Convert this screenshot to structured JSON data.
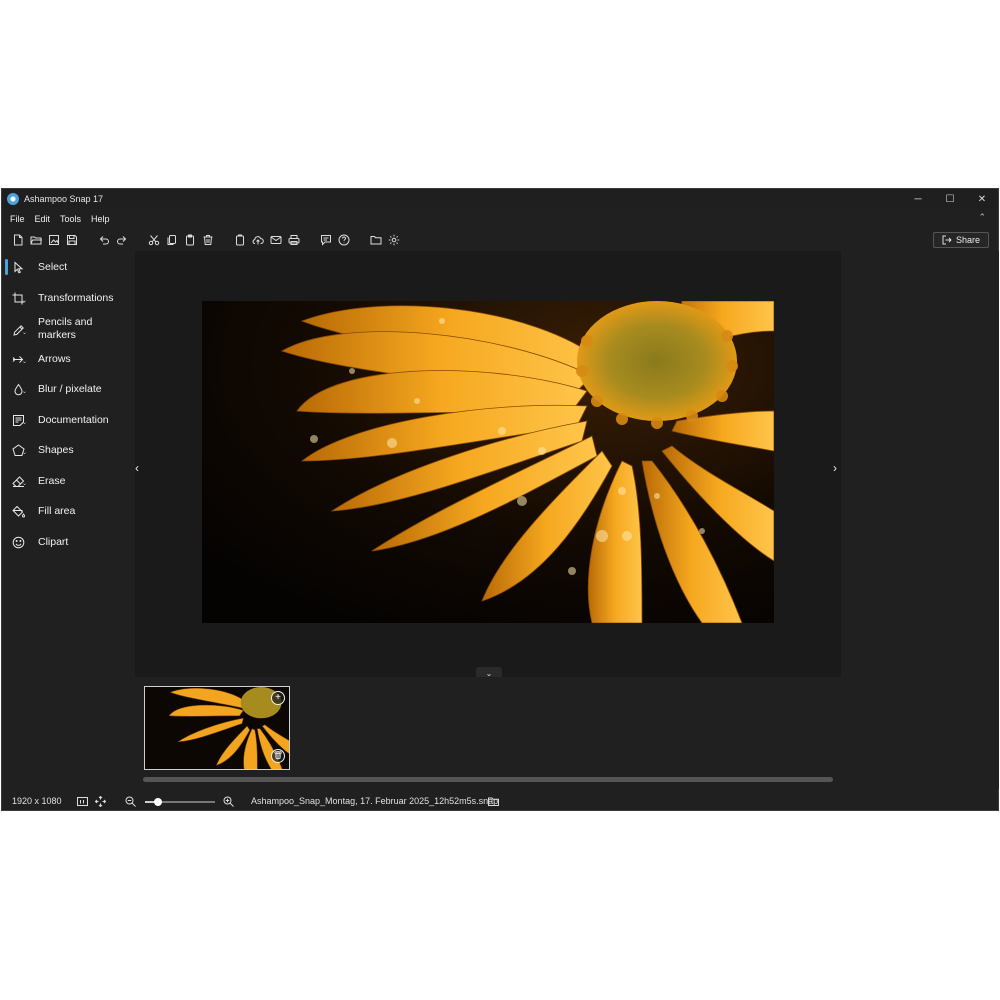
{
  "window": {
    "title": "Ashampoo Snap 17",
    "controls": [
      "─",
      "☐",
      "✕"
    ]
  },
  "menu": {
    "items": [
      "File",
      "Edit",
      "Tools",
      "Help"
    ]
  },
  "toolbar": {
    "share_label": "Share"
  },
  "sidebar": {
    "items": [
      {
        "label": "Select",
        "icon": "cursor-icon",
        "active": true
      },
      {
        "label": "Transformations",
        "icon": "crop-icon"
      },
      {
        "label": "Pencils and markers",
        "icon": "pencil-icon"
      },
      {
        "label": "Arrows",
        "icon": "arrow-icon"
      },
      {
        "label": "Blur / pixelate",
        "icon": "drop-icon"
      },
      {
        "label": "Documentation",
        "icon": "document-icon"
      },
      {
        "label": "Shapes",
        "icon": "pentagon-icon"
      },
      {
        "label": "Erase",
        "icon": "eraser-icon"
      },
      {
        "label": "Fill area",
        "icon": "bucket-icon"
      },
      {
        "label": "Clipart",
        "icon": "smiley-icon"
      }
    ]
  },
  "status": {
    "dimensions": "1920 x 1080",
    "zoom_fraction": 0.18,
    "filename": "Ashampoo_Snap_Montag, 17. Februar 2025_12h52m5s.snap"
  },
  "colors": {
    "accent": "#4aa3df",
    "background": "#202020",
    "canvas": "#1a1a1a",
    "petal": "#f3a51f"
  }
}
